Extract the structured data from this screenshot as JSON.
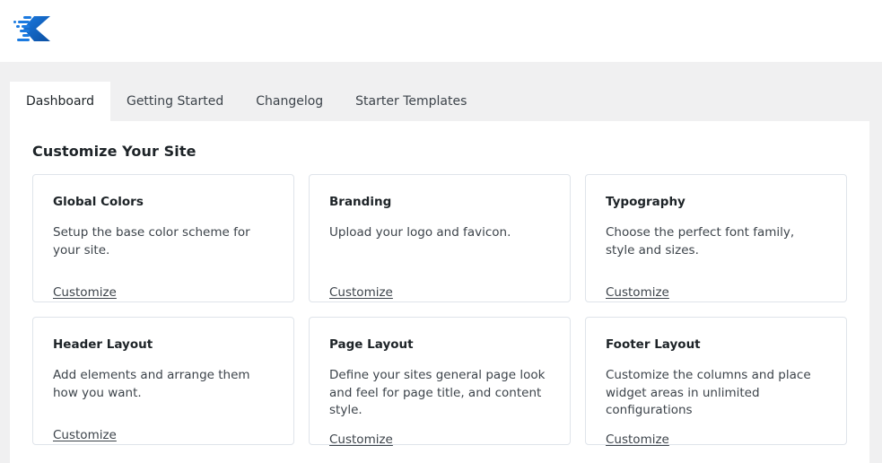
{
  "brand": {
    "logo_icon": "kadence-speed-logo-icon",
    "logo_color": "#1068c9",
    "logo_color_dark": "#0b4fa2"
  },
  "tabs": {
    "items": [
      {
        "label": "Dashboard",
        "active": true
      },
      {
        "label": "Getting Started",
        "active": false
      },
      {
        "label": "Changelog",
        "active": false
      },
      {
        "label": "Starter Templates",
        "active": false
      }
    ]
  },
  "main": {
    "title": "Customize Your Site",
    "cards": [
      {
        "title": "Global Colors",
        "description": "Setup the base color scheme for your site.",
        "link_label": "Customize"
      },
      {
        "title": "Branding",
        "description": "Upload your logo and favicon.",
        "link_label": "Customize"
      },
      {
        "title": "Typography",
        "description": "Choose the perfect font family, style and sizes.",
        "link_label": "Customize"
      },
      {
        "title": "Header Layout",
        "description": "Add elements and arrange them how you want.",
        "link_label": "Customize"
      },
      {
        "title": "Page Layout",
        "description": "Define your sites general page look and feel for page title, and content style.",
        "link_label": "Customize"
      },
      {
        "title": "Footer Layout",
        "description": "Customize the columns and place widget areas in unlimited configurations",
        "link_label": "Customize"
      }
    ]
  },
  "colors": {
    "page_background": "#f0f0f1",
    "panel_background": "#ffffff",
    "card_border": "#dfe4ea",
    "text_primary": "#1d2327",
    "text_secondary": "#3c434a"
  }
}
